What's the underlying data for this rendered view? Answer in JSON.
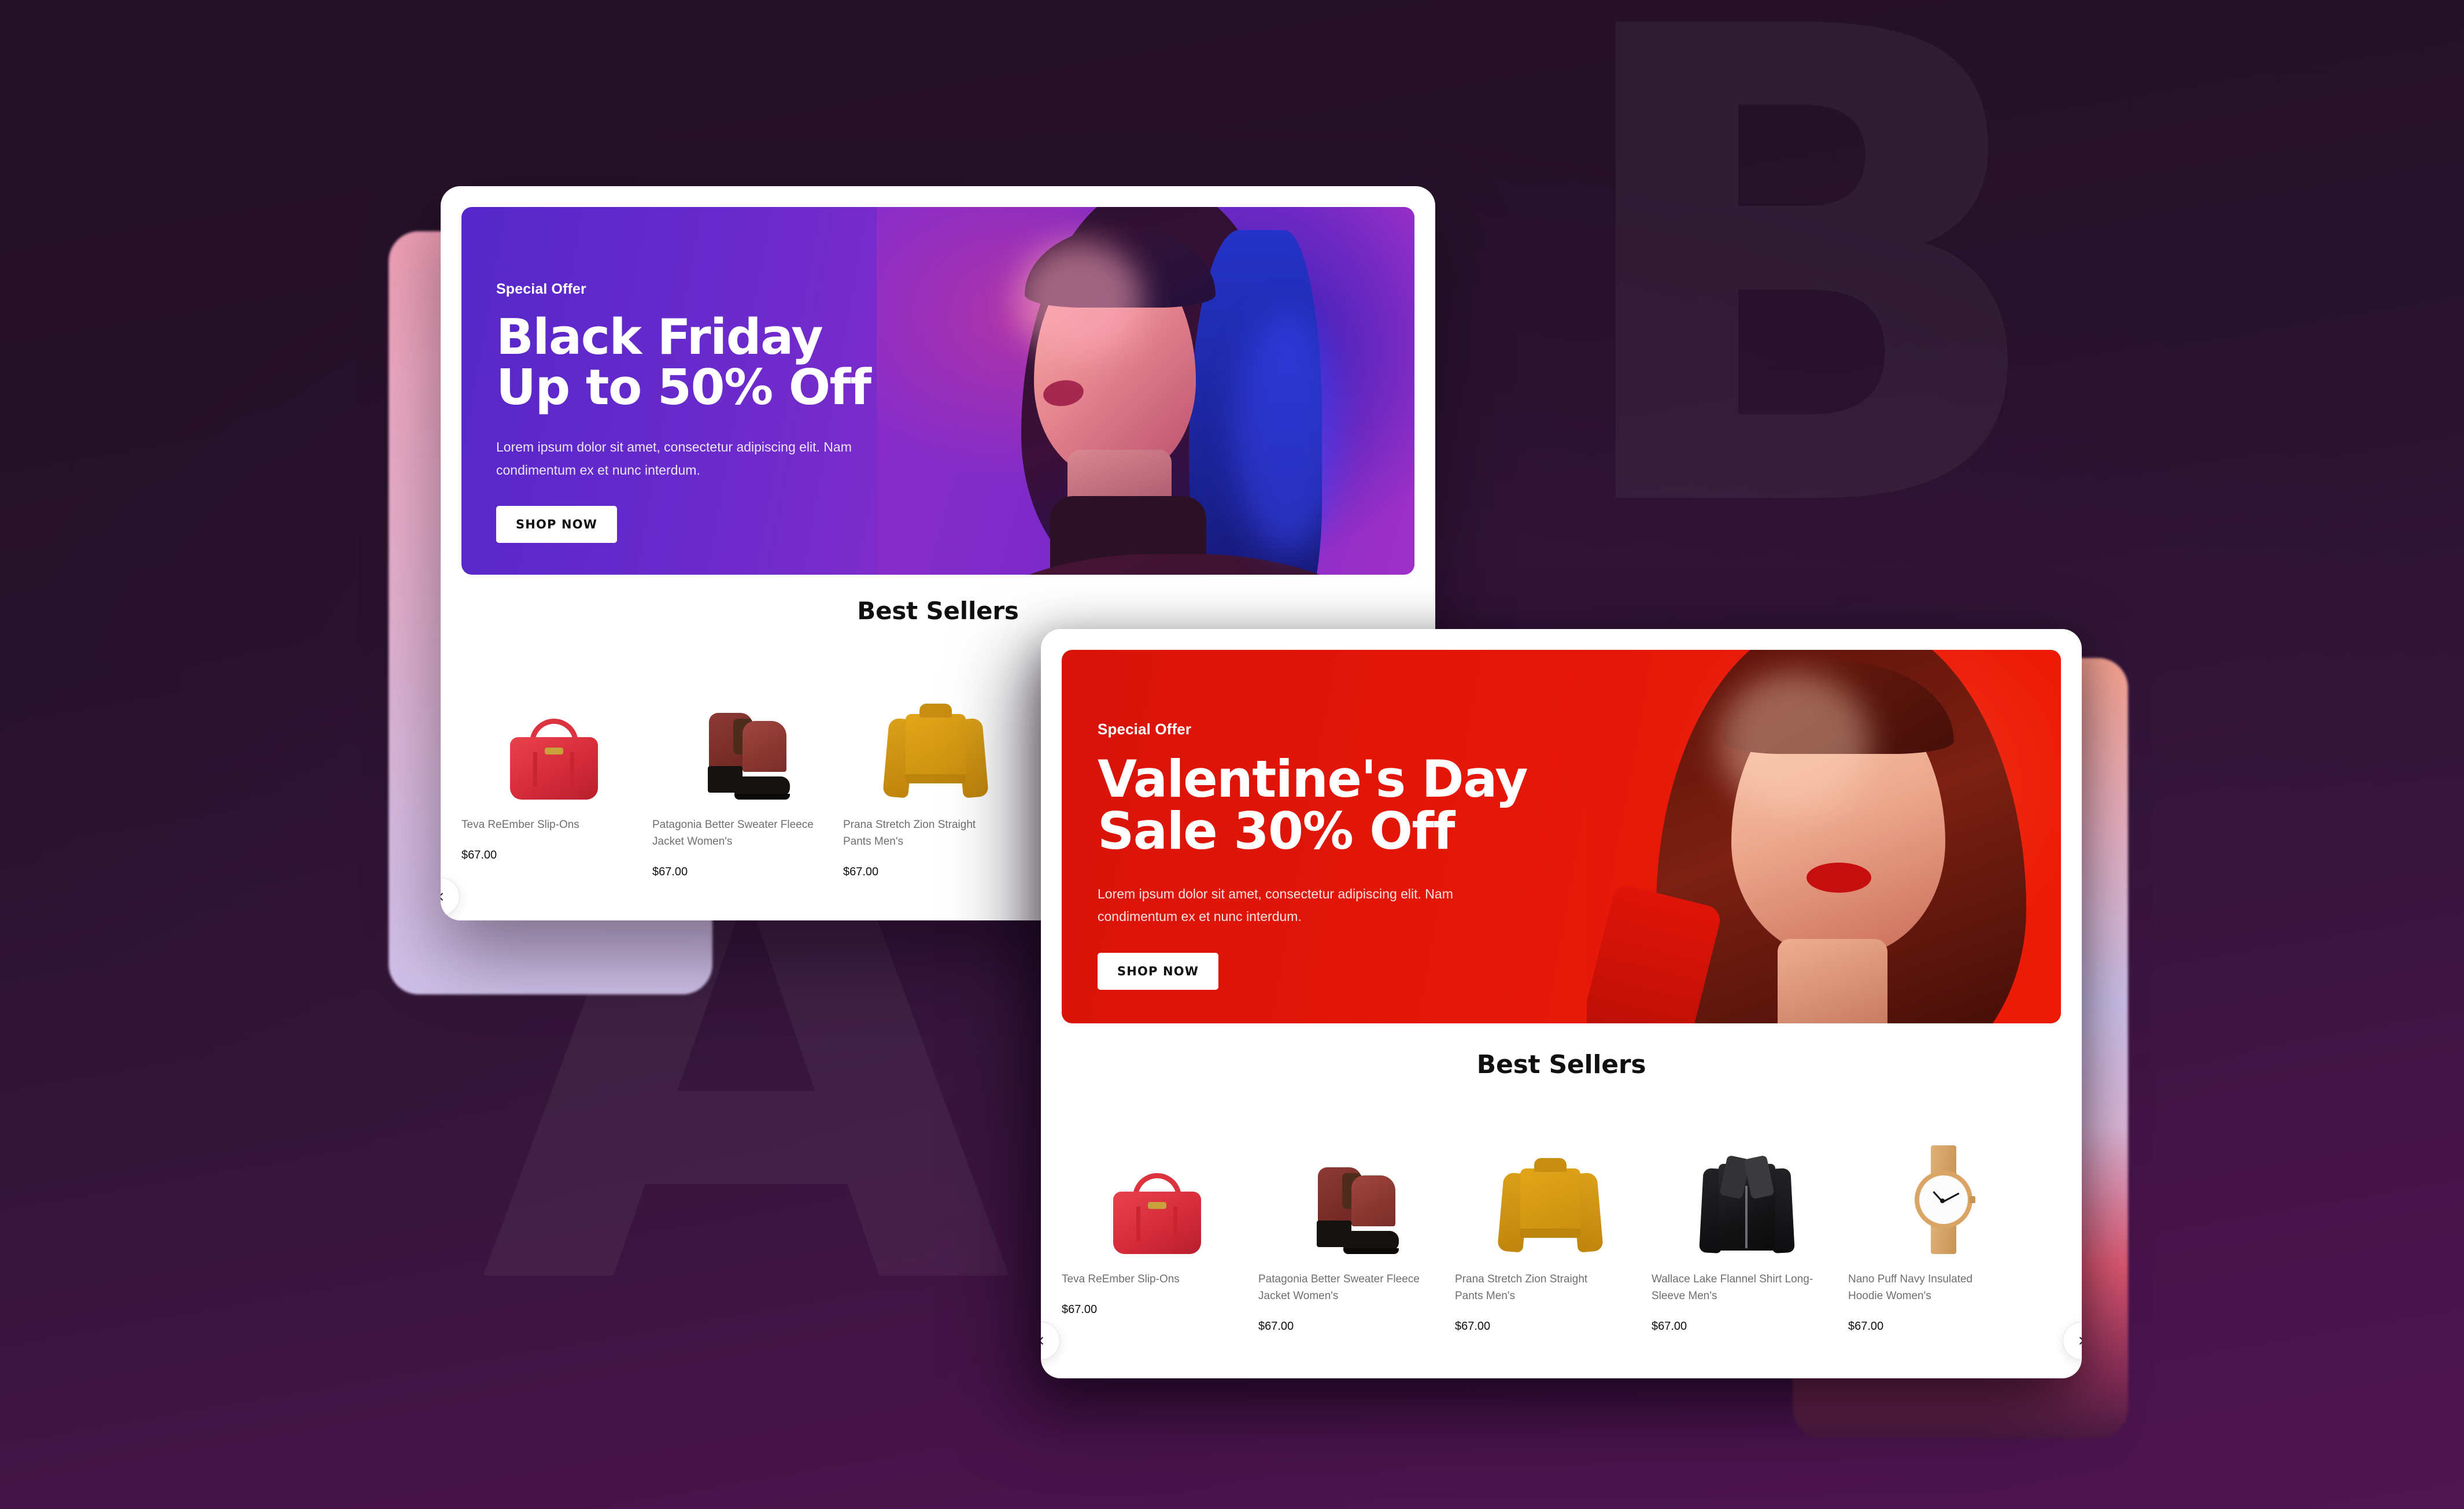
{
  "background": {
    "letter_b": "B",
    "letter_a": "A",
    "base_color": "#241026",
    "accent_color": "#4E1551"
  },
  "cards": [
    {
      "id": "back",
      "hero": {
        "eyebrow": "Special Offer",
        "headline_line1": "Black Friday",
        "headline_line2": "Up to 50% Off",
        "subcopy": "Lorem ipsum dolor sit amet, consectetur adipiscing elit. Nam condimentum ex et nunc interdum.",
        "cta_label": "SHOP NOW",
        "background_color": "#6A2ACC",
        "gradient_from": "#5427C8",
        "gradient_to": "#A632C6"
      },
      "best_sellers": {
        "title": "Best Sellers",
        "products": [
          {
            "name": "Teva ReEmber Slip-Ons",
            "price": "$67.00",
            "image": "red-handbag"
          },
          {
            "name": "Patagonia Better Sweater Fleece Jacket Women's",
            "price": "$67.00",
            "image": "brown-ankle-boots"
          },
          {
            "name": "Prana Stretch Zion Straight Pants Men's",
            "price": "$67.00",
            "image": "mustard-sweater"
          }
        ],
        "prev_label": "Previous"
      }
    },
    {
      "id": "front",
      "hero": {
        "eyebrow": "Special Offer",
        "headline_line1": "Valentine's Day",
        "headline_line2": "Sale 30% Off",
        "subcopy": "Lorem ipsum dolor sit amet, consectetur adipiscing elit. Nam condimentum ex et nunc interdum.",
        "cta_label": "SHOP NOW",
        "background_color": "#E51708",
        "gradient_from": "#D9130A",
        "gradient_to": "#EE1B06"
      },
      "best_sellers": {
        "title": "Best Sellers",
        "products": [
          {
            "name": "Teva ReEmber Slip-Ons",
            "price": "$67.00",
            "image": "red-handbag"
          },
          {
            "name": "Patagonia Better Sweater Fleece Jacket Women's",
            "price": "$67.00",
            "image": "brown-ankle-boots"
          },
          {
            "name": "Prana Stretch Zion Straight Pants Men's",
            "price": "$67.00",
            "image": "mustard-sweater"
          },
          {
            "name": "Wallace Lake Flannel Shirt Long-Sleeve Men's",
            "price": "$67.00",
            "image": "black-leather-jacket"
          },
          {
            "name": "Nano Puff Navy Insulated Hoodie Women's",
            "price": "$67.00",
            "image": "rose-gold-watch"
          }
        ],
        "prev_label": "Previous",
        "next_label": "Next"
      }
    }
  ]
}
